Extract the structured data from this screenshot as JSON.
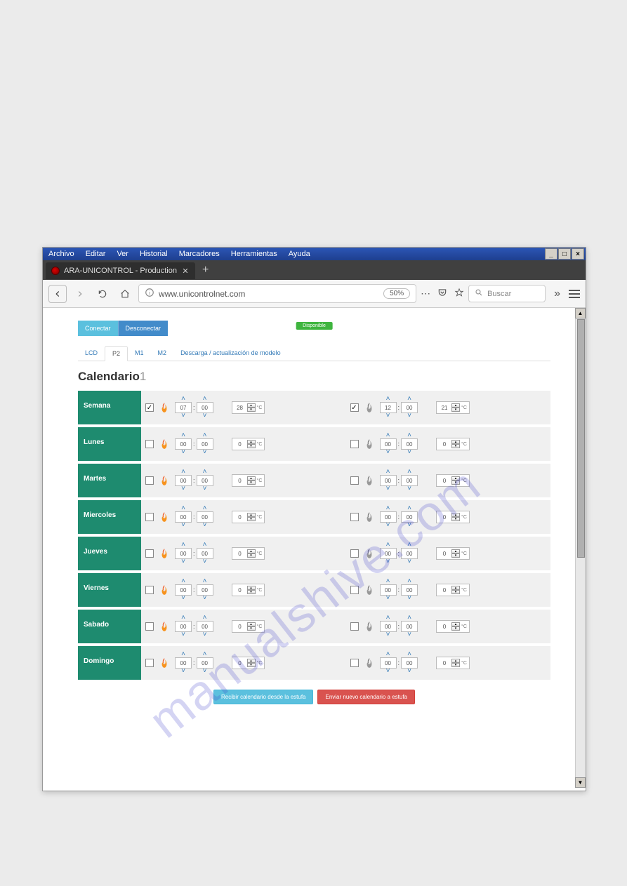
{
  "menubar": [
    "Archivo",
    "Editar",
    "Ver",
    "Historial",
    "Marcadores",
    "Herramientas",
    "Ayuda"
  ],
  "tab": {
    "title": "ARA-UNICONTROL - Production"
  },
  "url": "www.unicontrolnet.com",
  "zoom": "50%",
  "search_placeholder": "Buscar",
  "status_pill": "Disponible",
  "connect": "Conectar",
  "disconnect": "Desconectar",
  "nav_tabs": [
    "LCD",
    "P2",
    "M1",
    "M2",
    "Descarga / actualización de modelo"
  ],
  "section_title": "Calendario",
  "section_num": "1",
  "recv_btn": "Recibir calendario desde la estufa",
  "send_btn": "Enviar nuevo calendario a estufa",
  "watermark": "manualshive.com",
  "rows": [
    {
      "day": "Semana",
      "on1": true,
      "h1": "07",
      "m1": "00",
      "t1": "28",
      "on2": true,
      "h2": "12",
      "m2": "00",
      "t2": "21"
    },
    {
      "day": "Lunes",
      "on1": false,
      "h1": "00",
      "m1": "00",
      "t1": "0",
      "on2": false,
      "h2": "00",
      "m2": "00",
      "t2": "0"
    },
    {
      "day": "Martes",
      "on1": false,
      "h1": "00",
      "m1": "00",
      "t1": "0",
      "on2": false,
      "h2": "00",
      "m2": "00",
      "t2": "0"
    },
    {
      "day": "Miercoles",
      "on1": false,
      "h1": "00",
      "m1": "00",
      "t1": "0",
      "on2": false,
      "h2": "00",
      "m2": "00",
      "t2": "0"
    },
    {
      "day": "Jueves",
      "on1": false,
      "h1": "00",
      "m1": "00",
      "t1": "0",
      "on2": false,
      "h2": "00",
      "m2": "00",
      "t2": "0"
    },
    {
      "day": "Viernes",
      "on1": false,
      "h1": "00",
      "m1": "00",
      "t1": "0",
      "on2": false,
      "h2": "00",
      "m2": "00",
      "t2": "0"
    },
    {
      "day": "Sabado",
      "on1": false,
      "h1": "00",
      "m1": "00",
      "t1": "0",
      "on2": false,
      "h2": "00",
      "m2": "00",
      "t2": "0"
    },
    {
      "day": "Domingo",
      "on1": false,
      "h1": "00",
      "m1": "00",
      "t1": "0",
      "on2": false,
      "h2": "00",
      "m2": "00",
      "t2": "0"
    }
  ]
}
